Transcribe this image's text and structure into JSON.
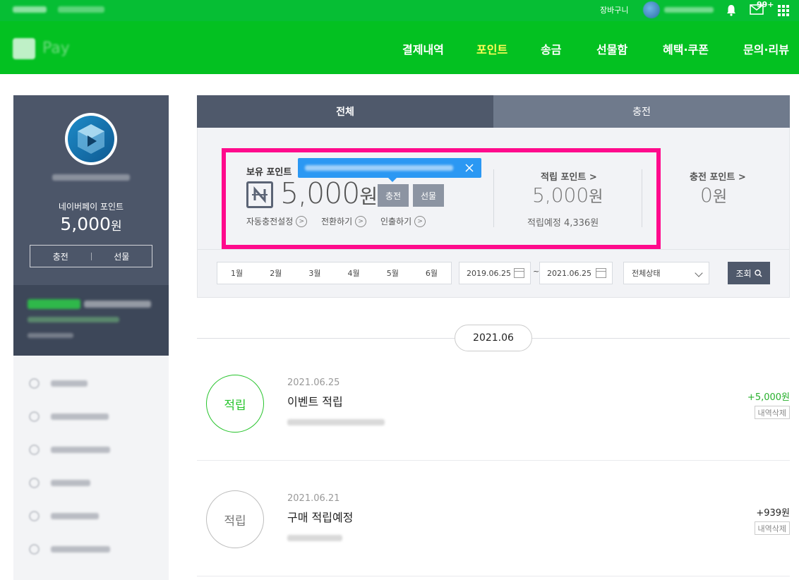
{
  "topbar": {
    "cart_label": "장바구니",
    "mail_count": "99+"
  },
  "nav": {
    "items": [
      {
        "label": "결제내역"
      },
      {
        "label": "포인트"
      },
      {
        "label": "송금"
      },
      {
        "label": "선물함"
      },
      {
        "label": "혜택·쿠폰"
      },
      {
        "label": "문의·리뷰"
      }
    ],
    "active_color": "#fffd55",
    "brand_color": "#03c121"
  },
  "sidebar": {
    "points_label": "네이버페이 포인트",
    "points_value": "5,000",
    "points_unit": "원",
    "charge_label": "충전",
    "gift_label": "선물"
  },
  "tabs": [
    {
      "label": "전체"
    },
    {
      "label": "충전"
    }
  ],
  "summary": {
    "hold_label": "보유 포인트",
    "hold_value": "5,000",
    "hold_unit": "원",
    "charge_btn": "충전",
    "gift_btn": "선물",
    "auto_charge": "자동충전설정",
    "convert": "전환하기",
    "withdraw": "인출하기",
    "earn_title": "적립 포인트 >",
    "earn_value": "5,000",
    "earn_unit": "원",
    "earn_expected": "적립예정 4,336원",
    "charge_title": "충전 포인트 >",
    "charge_value": "0",
    "charge_unit": "원"
  },
  "filter": {
    "months": [
      "1월",
      "2월",
      "3월",
      "4월",
      "5월",
      "6월"
    ],
    "start_date": "2019.06.25",
    "end_date": "2021.06.25",
    "tilde": "~",
    "status": "전체상태",
    "search_label": "조회"
  },
  "history": {
    "month": "2021.06",
    "delete_label": "내역삭제",
    "rows": [
      {
        "badge": "적립",
        "date": "2021.06.25",
        "title": "이벤트 적립",
        "amount": "+5,000원"
      },
      {
        "badge": "적립",
        "date": "2021.06.21",
        "title": "구매 적립예정",
        "amount": "+939원"
      }
    ]
  }
}
